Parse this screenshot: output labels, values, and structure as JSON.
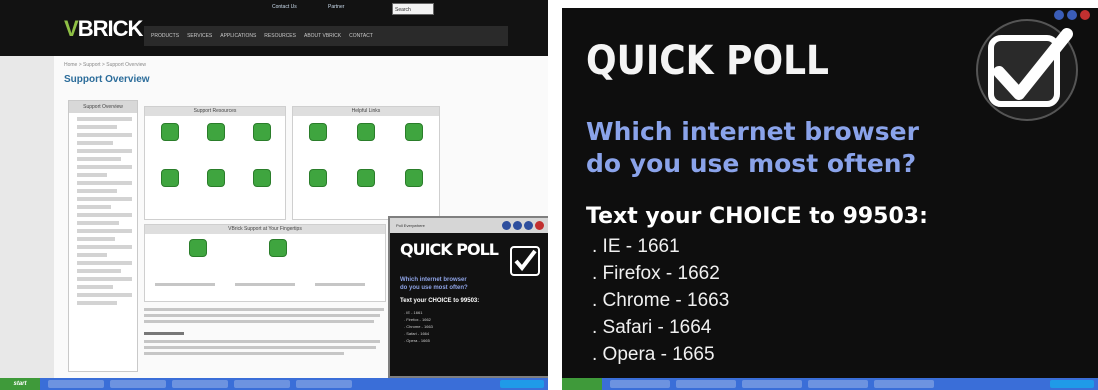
{
  "left": {
    "logo": {
      "prefix": "V",
      "rest": "BRICK"
    },
    "top_links": [
      "Contact Us",
      "Partner",
      "Search"
    ],
    "nav_items": [
      "PRODUCTS",
      "SERVICES",
      "APPLICATIONS",
      "RESOURCES",
      "ABOUT VBRICK",
      "CONTACT"
    ],
    "breadcrumb": "Home > Support > Support Overview",
    "page_title": "Support Overview",
    "sidebar_title": "Support Overview",
    "box1_title": "Support Resources",
    "box2_title": "Helpful Links",
    "box3_title": "VBrick Support at Your Fingertips",
    "poll": {
      "titlebar": "Poll Everywhere",
      "heading": "QUICK POLL",
      "question": "Which internet browser\ndo you use most often?",
      "instruction": "Text your CHOICE to 99503:",
      "options": [
        ". IE - 1661",
        ". Firefox - 1662",
        ". Chrome - 1663",
        ". Safari - 1664",
        ". Opera - 1665"
      ]
    },
    "taskbar": {
      "start": "start"
    }
  },
  "right": {
    "heading": "QUICK POLL",
    "question": "Which internet browser\ndo you use most often?",
    "instruction": "Text your CHOICE to 99503:",
    "options": [
      ". IE - 1661",
      ". Firefox - 1662",
      ". Chrome - 1663",
      ". Safari - 1664",
      ". Opera - 1665"
    ]
  },
  "colors": {
    "question": "#8aa3ea",
    "accent_green": "#3fa53f",
    "taskbar": "#3a6ed8"
  }
}
